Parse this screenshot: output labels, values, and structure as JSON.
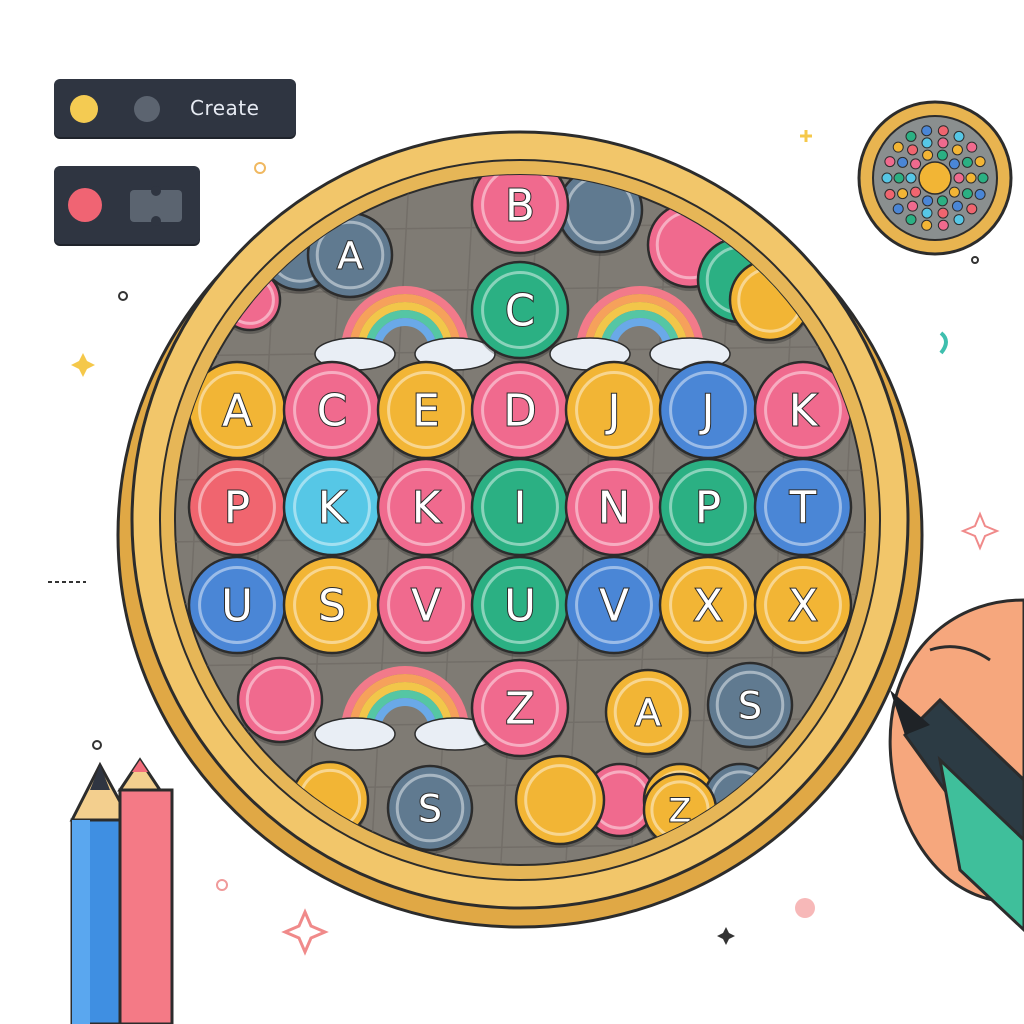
{
  "toolbar": {
    "create_label": "Create"
  },
  "coin_letters": {
    "row0": [
      "A",
      "B",
      "C"
    ],
    "row1": [
      "A",
      "C",
      "E",
      "D",
      "J",
      "J",
      "K"
    ],
    "row2": [
      "P",
      "K",
      "K",
      "I",
      "N",
      "P",
      "T"
    ],
    "row3": [
      "U",
      "S",
      "V",
      "U",
      "V",
      "X",
      "X"
    ],
    "row4": [
      "Z",
      "A",
      "S"
    ],
    "row5": [
      "S",
      "Z"
    ]
  },
  "colors": {
    "rim": "#e6b24e",
    "tray": "#7f7b74",
    "coin_yellow": "#f2b535",
    "coin_pink": "#f06a8e",
    "coin_blue": "#4a86d6",
    "coin_cyan": "#56c7e6",
    "coin_green": "#2bb083",
    "coin_red": "#f0656f",
    "coin_slate": "#607a90"
  },
  "icons": [
    "yellow-dot-icon",
    "gray-dot-icon",
    "red-dot-icon",
    "puzzle-icon",
    "pencil-icon",
    "marker-icon",
    "sparkle-icon"
  ]
}
